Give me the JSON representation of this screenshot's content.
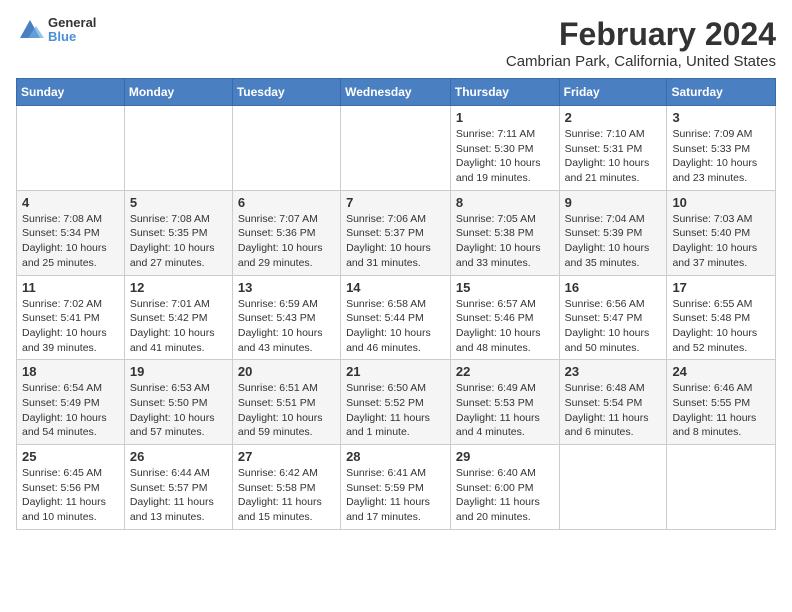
{
  "logo": {
    "general": "General",
    "blue": "Blue"
  },
  "title": "February 2024",
  "subtitle": "Cambrian Park, California, United States",
  "days_of_week": [
    "Sunday",
    "Monday",
    "Tuesday",
    "Wednesday",
    "Thursday",
    "Friday",
    "Saturday"
  ],
  "weeks": [
    [
      {
        "day": "",
        "info": ""
      },
      {
        "day": "",
        "info": ""
      },
      {
        "day": "",
        "info": ""
      },
      {
        "day": "",
        "info": ""
      },
      {
        "day": "1",
        "info": "Sunrise: 7:11 AM\nSunset: 5:30 PM\nDaylight: 10 hours\nand 19 minutes."
      },
      {
        "day": "2",
        "info": "Sunrise: 7:10 AM\nSunset: 5:31 PM\nDaylight: 10 hours\nand 21 minutes."
      },
      {
        "day": "3",
        "info": "Sunrise: 7:09 AM\nSunset: 5:33 PM\nDaylight: 10 hours\nand 23 minutes."
      }
    ],
    [
      {
        "day": "4",
        "info": "Sunrise: 7:08 AM\nSunset: 5:34 PM\nDaylight: 10 hours\nand 25 minutes."
      },
      {
        "day": "5",
        "info": "Sunrise: 7:08 AM\nSunset: 5:35 PM\nDaylight: 10 hours\nand 27 minutes."
      },
      {
        "day": "6",
        "info": "Sunrise: 7:07 AM\nSunset: 5:36 PM\nDaylight: 10 hours\nand 29 minutes."
      },
      {
        "day": "7",
        "info": "Sunrise: 7:06 AM\nSunset: 5:37 PM\nDaylight: 10 hours\nand 31 minutes."
      },
      {
        "day": "8",
        "info": "Sunrise: 7:05 AM\nSunset: 5:38 PM\nDaylight: 10 hours\nand 33 minutes."
      },
      {
        "day": "9",
        "info": "Sunrise: 7:04 AM\nSunset: 5:39 PM\nDaylight: 10 hours\nand 35 minutes."
      },
      {
        "day": "10",
        "info": "Sunrise: 7:03 AM\nSunset: 5:40 PM\nDaylight: 10 hours\nand 37 minutes."
      }
    ],
    [
      {
        "day": "11",
        "info": "Sunrise: 7:02 AM\nSunset: 5:41 PM\nDaylight: 10 hours\nand 39 minutes."
      },
      {
        "day": "12",
        "info": "Sunrise: 7:01 AM\nSunset: 5:42 PM\nDaylight: 10 hours\nand 41 minutes."
      },
      {
        "day": "13",
        "info": "Sunrise: 6:59 AM\nSunset: 5:43 PM\nDaylight: 10 hours\nand 43 minutes."
      },
      {
        "day": "14",
        "info": "Sunrise: 6:58 AM\nSunset: 5:44 PM\nDaylight: 10 hours\nand 46 minutes."
      },
      {
        "day": "15",
        "info": "Sunrise: 6:57 AM\nSunset: 5:46 PM\nDaylight: 10 hours\nand 48 minutes."
      },
      {
        "day": "16",
        "info": "Sunrise: 6:56 AM\nSunset: 5:47 PM\nDaylight: 10 hours\nand 50 minutes."
      },
      {
        "day": "17",
        "info": "Sunrise: 6:55 AM\nSunset: 5:48 PM\nDaylight: 10 hours\nand 52 minutes."
      }
    ],
    [
      {
        "day": "18",
        "info": "Sunrise: 6:54 AM\nSunset: 5:49 PM\nDaylight: 10 hours\nand 54 minutes."
      },
      {
        "day": "19",
        "info": "Sunrise: 6:53 AM\nSunset: 5:50 PM\nDaylight: 10 hours\nand 57 minutes."
      },
      {
        "day": "20",
        "info": "Sunrise: 6:51 AM\nSunset: 5:51 PM\nDaylight: 10 hours\nand 59 minutes."
      },
      {
        "day": "21",
        "info": "Sunrise: 6:50 AM\nSunset: 5:52 PM\nDaylight: 11 hours\nand 1 minute."
      },
      {
        "day": "22",
        "info": "Sunrise: 6:49 AM\nSunset: 5:53 PM\nDaylight: 11 hours\nand 4 minutes."
      },
      {
        "day": "23",
        "info": "Sunrise: 6:48 AM\nSunset: 5:54 PM\nDaylight: 11 hours\nand 6 minutes."
      },
      {
        "day": "24",
        "info": "Sunrise: 6:46 AM\nSunset: 5:55 PM\nDaylight: 11 hours\nand 8 minutes."
      }
    ],
    [
      {
        "day": "25",
        "info": "Sunrise: 6:45 AM\nSunset: 5:56 PM\nDaylight: 11 hours\nand 10 minutes."
      },
      {
        "day": "26",
        "info": "Sunrise: 6:44 AM\nSunset: 5:57 PM\nDaylight: 11 hours\nand 13 minutes."
      },
      {
        "day": "27",
        "info": "Sunrise: 6:42 AM\nSunset: 5:58 PM\nDaylight: 11 hours\nand 15 minutes."
      },
      {
        "day": "28",
        "info": "Sunrise: 6:41 AM\nSunset: 5:59 PM\nDaylight: 11 hours\nand 17 minutes."
      },
      {
        "day": "29",
        "info": "Sunrise: 6:40 AM\nSunset: 6:00 PM\nDaylight: 11 hours\nand 20 minutes."
      },
      {
        "day": "",
        "info": ""
      },
      {
        "day": "",
        "info": ""
      }
    ]
  ]
}
